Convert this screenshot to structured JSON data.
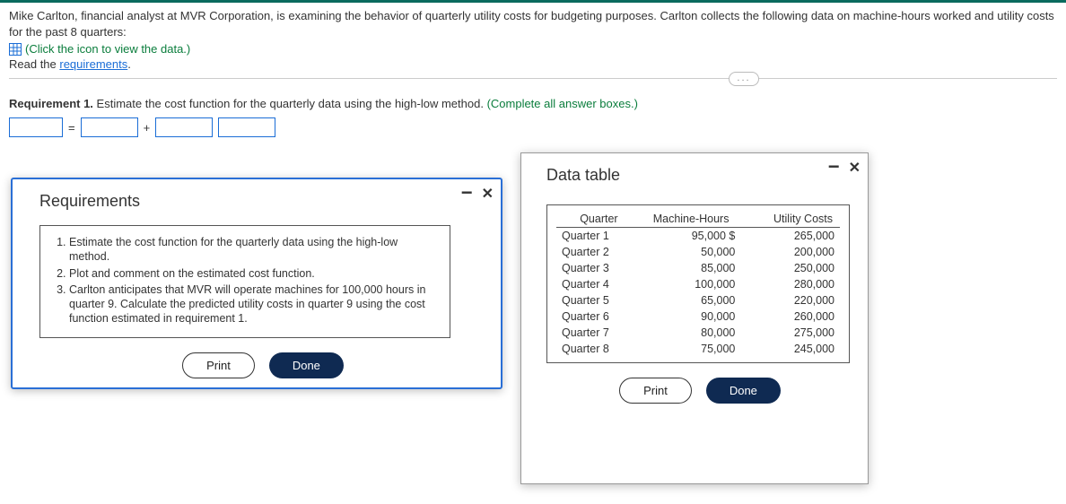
{
  "intro": "Mike Carlton, financial analyst at MVR Corporation, is examining the behavior of quarterly utility costs for budgeting purposes. Carlton collects the following data on machine-hours worked and utility costs for the past 8 quarters:",
  "view_data_hint": "(Click the icon to view the data.)",
  "read_prefix": "Read the ",
  "read_link": "requirements",
  "read_suffix": ".",
  "req1": {
    "label": "Requirement 1.",
    "text": " Estimate the cost function for the quarterly data using the high-low method. ",
    "hint": "(Complete all answer boxes.)"
  },
  "eq": {
    "equals": "=",
    "plus": "+"
  },
  "modals": {
    "requirements": {
      "title": "Requirements",
      "items": [
        "Estimate the cost function for the quarterly data using the high-low method.",
        "Plot and comment on the estimated cost function.",
        "Carlton anticipates that MVR will operate machines for 100,000 hours in quarter 9. Calculate the predicted utility costs in quarter 9 using the cost function estimated in requirement 1."
      ],
      "print": "Print",
      "done": "Done"
    },
    "data": {
      "title": "Data table",
      "headers": {
        "quarter": "Quarter",
        "mh": "Machine-Hours",
        "uc": "Utility Costs"
      },
      "currency": "$",
      "rows": [
        {
          "q": "Quarter 1",
          "mh": "95,000",
          "uc": "265,000"
        },
        {
          "q": "Quarter 2",
          "mh": "50,000",
          "uc": "200,000"
        },
        {
          "q": "Quarter 3",
          "mh": "85,000",
          "uc": "250,000"
        },
        {
          "q": "Quarter 4",
          "mh": "100,000",
          "uc": "280,000"
        },
        {
          "q": "Quarter 5",
          "mh": "65,000",
          "uc": "220,000"
        },
        {
          "q": "Quarter 6",
          "mh": "90,000",
          "uc": "260,000"
        },
        {
          "q": "Quarter 7",
          "mh": "80,000",
          "uc": "275,000"
        },
        {
          "q": "Quarter 8",
          "mh": "75,000",
          "uc": "245,000"
        }
      ],
      "print": "Print",
      "done": "Done"
    }
  },
  "ellipsis": "..."
}
